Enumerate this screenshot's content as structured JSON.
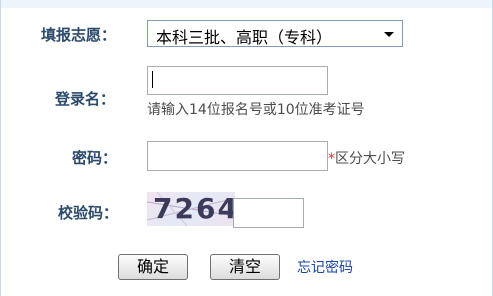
{
  "form": {
    "volunteer": {
      "label": "填报志愿：",
      "selected": "本科三批、高职（专科）"
    },
    "username": {
      "label": "登录名：",
      "value": "",
      "hint": "请输入14位报名号或10位准考证号"
    },
    "password": {
      "label": "密码：",
      "value": "",
      "required_mark": "*",
      "hint": "区分大小写"
    },
    "captcha": {
      "label": "校验码：",
      "image_text": "7264",
      "value": ""
    },
    "buttons": {
      "confirm": "确定",
      "clear": "清空"
    },
    "forgot_password_link": "忘记密码"
  },
  "colors": {
    "label": "#2c4a6b",
    "link": "#1a44a8",
    "required": "#e0302d",
    "captcha_bg": "#e8e4f3"
  }
}
